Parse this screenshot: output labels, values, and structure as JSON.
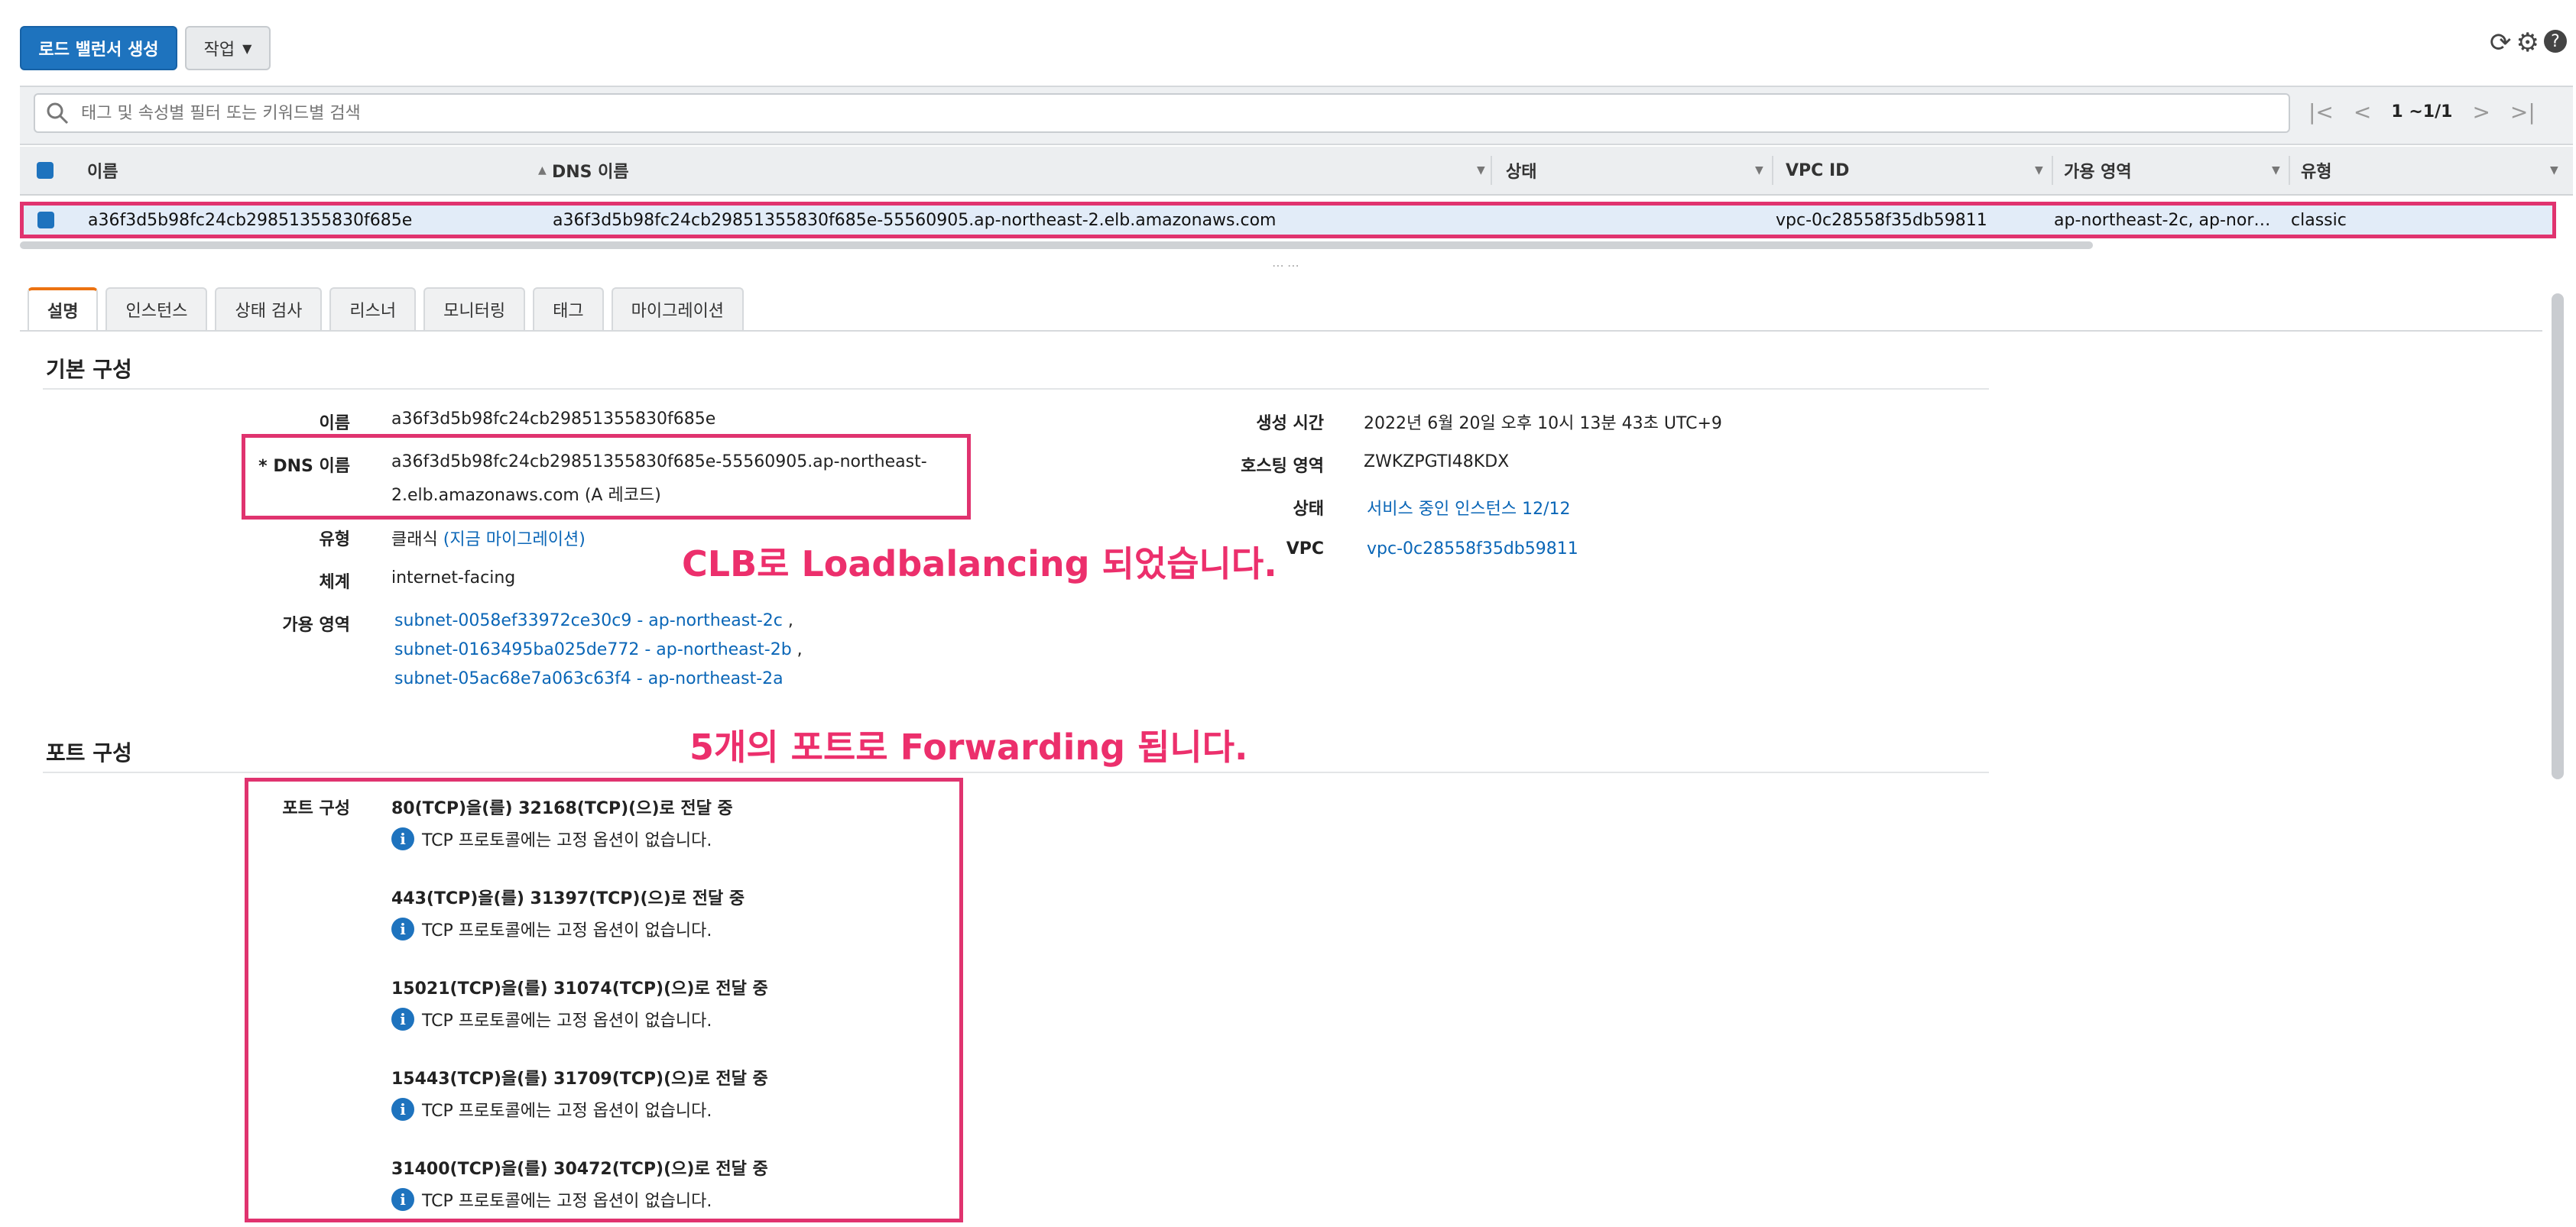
{
  "toolbar": {
    "create_label": "로드 밸런서 생성",
    "actions_label": "작업"
  },
  "search": {
    "placeholder": "태그 및 속성별 필터 또는 키워드별 검색"
  },
  "pager": {
    "text": "1 ~1/1"
  },
  "table": {
    "columns": [
      "이름",
      "DNS 이름",
      "상태",
      "VPC ID",
      "가용 영역",
      "유형"
    ],
    "row": {
      "name": "a36f3d5b98fc24cb29851355830f685e",
      "dns": "a36f3d5b98fc24cb29851355830f685e-55560905.ap-northeast-2.elb.amazonaws.com",
      "status": "",
      "vpc_id": "vpc-0c28558f35db59811",
      "az": "ap-northeast-2c, ap-nor…",
      "type": "classic"
    }
  },
  "tabs": [
    "설명",
    "인스턴스",
    "상태 검사",
    "리스너",
    "모니터링",
    "태그",
    "마이그레이션"
  ],
  "basic": {
    "title": "기본 구성",
    "name_label": "이름",
    "name_value": "a36f3d5b98fc24cb29851355830f685e",
    "dns_label": "* DNS 이름",
    "dns_value_line1": "a36f3d5b98fc24cb29851355830f685e-55560905.ap-northeast-",
    "dns_value_line2": "2.elb.amazonaws.com (A 레코드)",
    "type_label": "유형",
    "type_value": "클래식",
    "type_link": "(지금 마이그레이션)",
    "scheme_label": "체계",
    "scheme_value": "internet-facing",
    "az_label": "가용 영역",
    "subnets": [
      "subnet-0058ef33972ce30c9 - ap-northeast-2c",
      "subnet-0163495ba025de772 - ap-northeast-2b",
      "subnet-05ac68e7a063c63f4 - ap-northeast-2a"
    ],
    "created_label": "생성 시간",
    "created_value": "2022년 6월 20일 오후 10시 13분 43초 UTC+9",
    "hosted_zone_label": "호스팅 영역",
    "hosted_zone_value": "ZWKZPGTI48KDX",
    "status_label": "상태",
    "status_value": "서비스 중인 인스턴스 12/12",
    "vpc_label": "VPC",
    "vpc_value": "vpc-0c28558f35db59811"
  },
  "annotations": {
    "clb": "CLB로 Loadbalancing 되었습니다.",
    "ports": "5개의 포트로 Forwarding 됩니다."
  },
  "ports": {
    "title": "포트 구성",
    "label": "포트 구성",
    "note": "TCP 프로토콜에는 고정 옵션이 없습니다.",
    "items": [
      "80(TCP)을(를) 32168(TCP)(으)로 전달 중",
      "443(TCP)을(를) 31397(TCP)(으)로 전달 중",
      "15021(TCP)을(를) 31074(TCP)(으)로 전달 중",
      "15443(TCP)을(를) 31709(TCP)(으)로 전달 중",
      "31400(TCP)을(를) 30472(TCP)(으)로 전달 중"
    ]
  },
  "colors": {
    "primary": "#1e73be",
    "highlight": "#e0336f",
    "annotation": "#ec2f6c",
    "link": "#0a66b7",
    "tab_accent": "#ec7211"
  },
  "icons": [
    "refresh-icon",
    "gear-icon",
    "help-icon",
    "search-icon",
    "first-page-icon",
    "prev-page-icon",
    "next-page-icon",
    "last-page-icon",
    "info-icon"
  ]
}
